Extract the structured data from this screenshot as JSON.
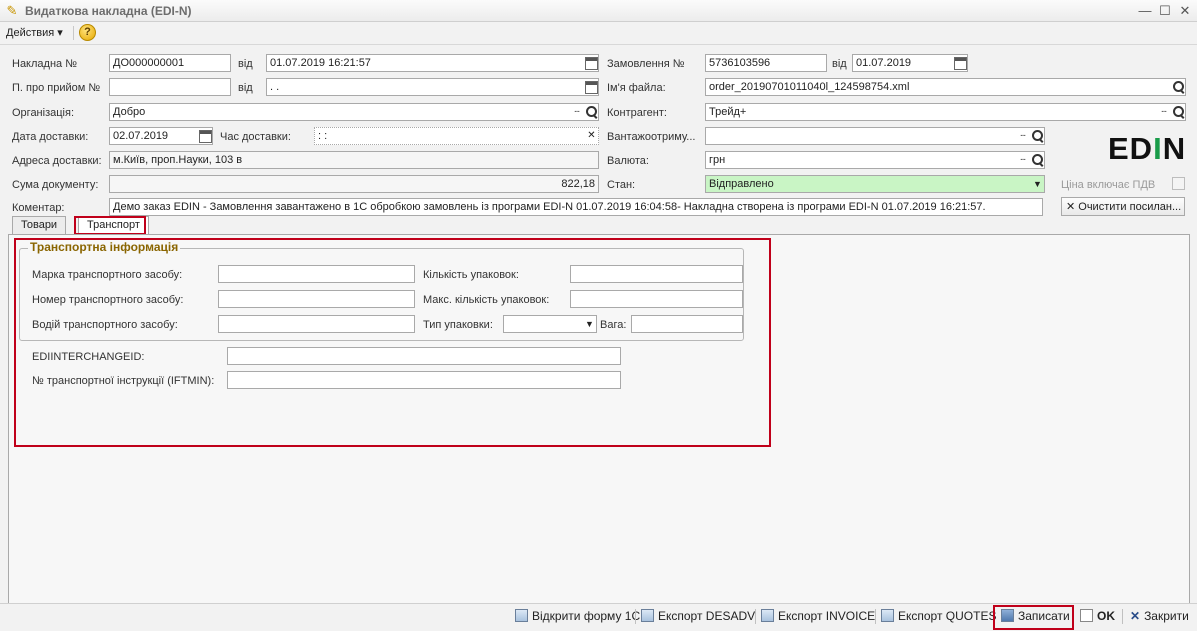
{
  "window": {
    "title": "Видаткова накладна (EDI-N)"
  },
  "toolbar": {
    "actions_label": "Действия ▾",
    "help_label": "?"
  },
  "form": {
    "invoice_no_label": "Накладна №",
    "invoice_no": "ДО000000001",
    "from_label_1": "від",
    "invoice_date": "01.07.2019 16:21:57",
    "receipt_no_label": "П. про прийом №",
    "receipt_no": "",
    "from_label_2": "від",
    "receipt_date": " .  .",
    "org_label": "Організація:",
    "org": "Добро",
    "delivery_date_label": "Дата доставки:",
    "delivery_date": "02.07.2019",
    "delivery_time_label": "Час доставки:",
    "delivery_time": " :  :",
    "delivery_addr_label": "Адреса доставки:",
    "delivery_addr": "м.Київ, проп.Науки, 103 в",
    "doc_sum_label": "Сума документу:",
    "doc_sum": "822,18",
    "comment_label": "Коментар:",
    "comment": "Демо заказ EDIN - Замовлення завантажено в 1С обробкою замовлень із програми EDI-N 01.07.2019 16:04:58- Накладна створена із програми EDI-N 01.07.2019 16:21:57.",
    "order_no_label": "Замовлення №",
    "order_no": "5736103596",
    "from_label_3": "від",
    "order_date": "01.07.2019",
    "filename_label": "Ім'я файла:",
    "filename": "order_20190701011040l_124598754.xml",
    "counterparty_label": "Контрагент:",
    "counterparty": "Трейд+",
    "consignee_label": "Вантажоотриму...",
    "consignee": "",
    "currency_label": "Валюта:",
    "currency": "грн",
    "state_label": "Стан:",
    "state": "Відправлено",
    "vat_label": "Ціна включає ПДВ",
    "clear_links_label": "✕ Очистити посилан..."
  },
  "logo": {
    "text_a": "ED",
    "text_b": "I",
    "text_c": "N"
  },
  "tabs": [
    {
      "label": "Товари"
    },
    {
      "label": "Транспорт"
    }
  ],
  "transport": {
    "group_title": "Транспортна інформація",
    "vehicle_brand_label": "Марка транспортного засобу:",
    "vehicle_number_label": "Номер транспортного засобу:",
    "driver_label": "Водій транспортного засобу:",
    "packages_count_label": "Кількість упаковок:",
    "max_packages_label": "Макс. кількість упаковок:",
    "package_type_label": "Тип упаковки:",
    "weight_label": "Вага:",
    "interchange_label": "EDIINTERCHANGEID:",
    "iftmin_label": "№ транспортної інструкції (IFTMIN):"
  },
  "bottom": {
    "open_1c": "Відкрити форму 1С",
    "export_desadv": "Експорт DESADV",
    "export_invoice": "Експорт INVOICE",
    "export_quotes": "Експорт QUOTES",
    "save": "Записати",
    "ok": "OK",
    "close": "Закрити"
  },
  "colors": {
    "state_bg": "#c9f5c5",
    "highlight": "#c0001a",
    "logo_green": "#1a9c4a"
  }
}
